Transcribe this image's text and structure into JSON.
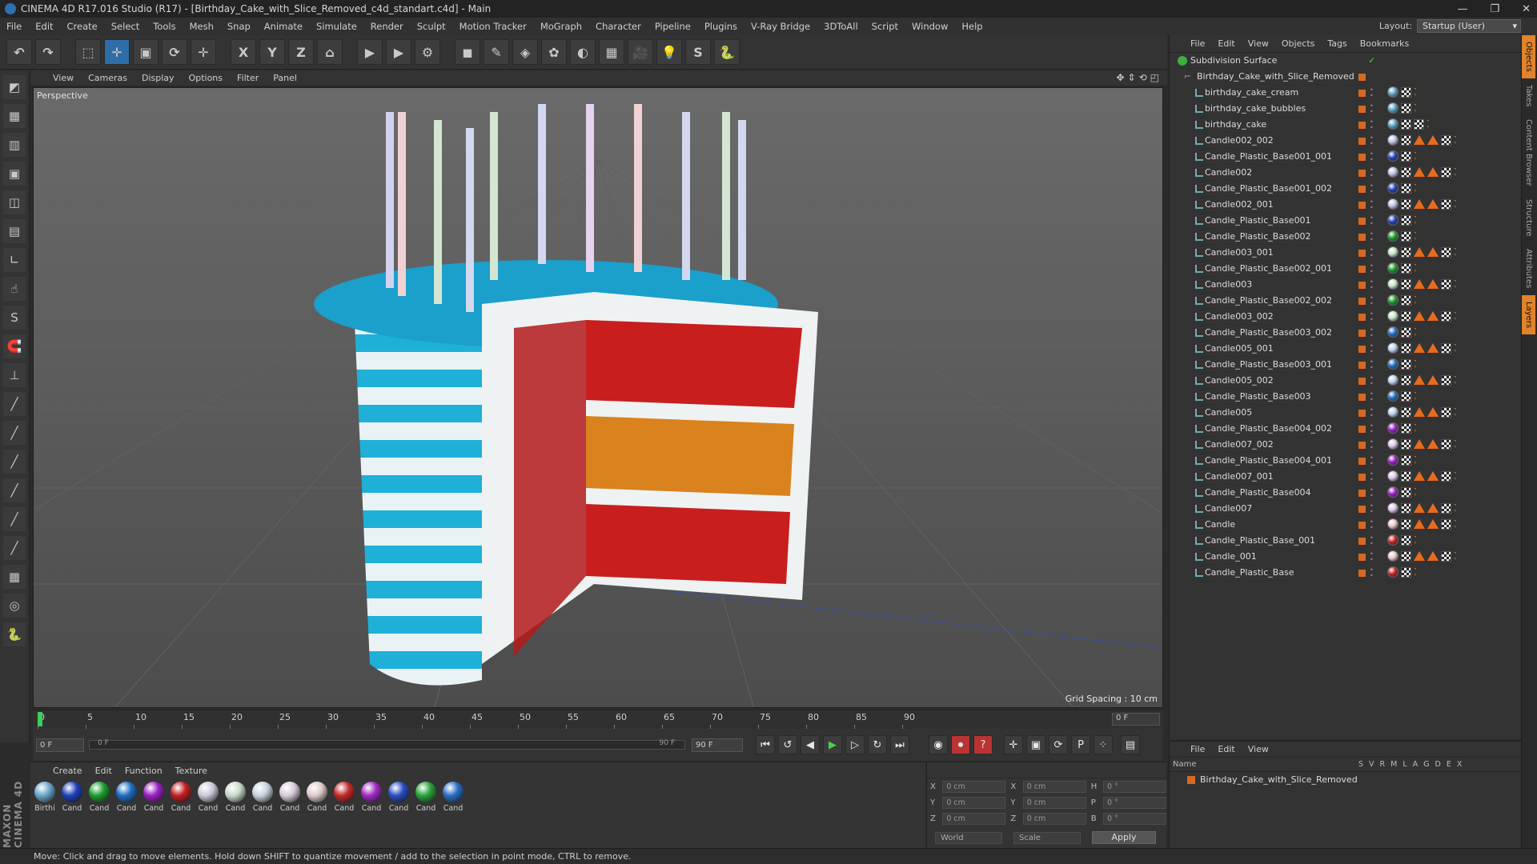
{
  "window": {
    "title": "CINEMA 4D R17.016 Studio (R17) - [Birthday_Cake_with_Slice_Removed_c4d_standart.c4d] - Main",
    "controls": [
      "—",
      "❐",
      "✕"
    ]
  },
  "menubar": {
    "items": [
      "File",
      "Edit",
      "Create",
      "Select",
      "Tools",
      "Mesh",
      "Snap",
      "Animate",
      "Simulate",
      "Render",
      "Sculpt",
      "Motion Tracker",
      "MoGraph",
      "Character",
      "Pipeline",
      "Plugins",
      "V-Ray Bridge",
      "3DToAll",
      "Script",
      "Window",
      "Help"
    ],
    "layout_label": "Layout:",
    "layout_value": "Startup (User)"
  },
  "toolbar": {
    "buttons": [
      {
        "name": "undo-icon",
        "glyph": "↶"
      },
      {
        "name": "redo-icon",
        "glyph": "↷"
      },
      {
        "name": "live-selection-icon",
        "glyph": "⬚"
      },
      {
        "name": "move-icon",
        "glyph": "✛"
      },
      {
        "name": "scale-icon",
        "glyph": "▣"
      },
      {
        "name": "rotate-icon",
        "glyph": "⟳"
      },
      {
        "name": "last-tool-icon",
        "glyph": "✛"
      },
      {
        "name": "x-axis-icon",
        "glyph": "X"
      },
      {
        "name": "y-axis-icon",
        "glyph": "Y"
      },
      {
        "name": "z-axis-icon",
        "glyph": "Z"
      },
      {
        "name": "coordinate-system-icon",
        "glyph": "⌂"
      },
      {
        "name": "render-view-icon",
        "glyph": "▶"
      },
      {
        "name": "render-picture-viewer-icon",
        "glyph": "▶"
      },
      {
        "name": "render-settings-icon",
        "glyph": "⚙"
      },
      {
        "name": "cube-icon",
        "glyph": "◼"
      },
      {
        "name": "pen-icon",
        "glyph": "✎"
      },
      {
        "name": "subdivision-icon",
        "glyph": "◈"
      },
      {
        "name": "array-icon",
        "glyph": "✿"
      },
      {
        "name": "deformer-icon",
        "glyph": "◐"
      },
      {
        "name": "floor-icon",
        "glyph": "▦"
      },
      {
        "name": "camera-icon",
        "glyph": "🎥"
      },
      {
        "name": "light-icon",
        "glyph": "💡"
      },
      {
        "name": "script-icon",
        "glyph": "S"
      },
      {
        "name": "python-icon",
        "glyph": "🐍"
      }
    ]
  },
  "left_tools": [
    "◩",
    "▦",
    "▥",
    "▣",
    "◫",
    "▤",
    "∟",
    "☝",
    "S",
    "🧲",
    "⊥",
    "╱",
    "╱",
    "╱",
    "╱",
    "╱",
    "╱",
    "▦",
    "◎",
    "🐍"
  ],
  "maxon": "MAXON CINEMA 4D",
  "viewport": {
    "menu": [
      "View",
      "Cameras",
      "Display",
      "Options",
      "Filter",
      "Panel"
    ],
    "nav": "✥⇕⟲◰",
    "label": "Perspective",
    "grid_spacing": "Grid Spacing : 10 cm"
  },
  "timeline": {
    "ticks": [
      "0",
      "5",
      "10",
      "15",
      "20",
      "25",
      "30",
      "35",
      "40",
      "45",
      "50",
      "55",
      "60",
      "65",
      "70",
      "75",
      "80",
      "85",
      "90"
    ],
    "current_frame": "0 F"
  },
  "transport": {
    "start_field": "0 F",
    "range_start": "0 F",
    "range_end": "90 F",
    "end_field": "90 F",
    "buttons": [
      "⏮",
      "↺",
      "◀",
      "▶",
      "▷",
      "↻",
      "⏭"
    ]
  },
  "materials": {
    "menu": [
      "Create",
      "Edit",
      "Function",
      "Texture"
    ],
    "items": [
      {
        "label": "Birthi",
        "color": "#6aa6c9"
      },
      {
        "label": "Cand",
        "color": "#1f3fb8"
      },
      {
        "label": "Cand",
        "color": "#1c9e2e"
      },
      {
        "label": "Cand",
        "color": "#1f6fc4"
      },
      {
        "label": "Cand",
        "color": "#9b1fc4"
      },
      {
        "label": "Cand",
        "color": "#c41f1f"
      },
      {
        "label": "Cand",
        "color": "#c9c9d9"
      },
      {
        "label": "Cand",
        "color": "#c9d9c9"
      },
      {
        "label": "Cand",
        "color": "#c9d2e0"
      },
      {
        "label": "Cand",
        "color": "#d9c9d9"
      },
      {
        "label": "Cand",
        "color": "#e0c9c9"
      },
      {
        "label": "Cand",
        "color": "#c42a2a"
      },
      {
        "label": "Cand",
        "color": "#a12ac4"
      },
      {
        "label": "Cand",
        "color": "#2a4fc4"
      },
      {
        "label": "Cand",
        "color": "#2aa43a"
      },
      {
        "label": "Cand",
        "color": "#2a6ec4"
      }
    ]
  },
  "coordinates": {
    "rows": [
      {
        "a": "X",
        "av": "0 cm",
        "b": "X",
        "bv": "0 cm",
        "c": "H",
        "cv": "0 °"
      },
      {
        "a": "Y",
        "av": "0 cm",
        "b": "Y",
        "bv": "0 cm",
        "c": "P",
        "cv": "0 °"
      },
      {
        "a": "Z",
        "av": "0 cm",
        "b": "Z",
        "bv": "0 cm",
        "c": "B",
        "cv": "0 °"
      }
    ],
    "mode": "World",
    "scale": "Scale",
    "apply": "Apply"
  },
  "status": "Move: Click and drag to move elements. Hold down SHIFT to quantize movement / add to the selection in point mode, CTRL to remove.",
  "objects": {
    "menu": [
      "File",
      "Edit",
      "View",
      "Objects",
      "Tags",
      "Bookmarks"
    ],
    "root": "Subdivision Surface",
    "group": "Birthday_Cake_with_Slice_Removed",
    "items": [
      {
        "name": "birthday_cake_cream",
        "tag": "#5fa3c8",
        "candle": false,
        "extra": false
      },
      {
        "name": "birthday_cake_bubbles",
        "tag": "#5fa3c8",
        "candle": false,
        "extra": false
      },
      {
        "name": "birthday_cake",
        "tag": "#5fa3c8",
        "candle": false,
        "extra": true
      },
      {
        "name": "Candle002_002",
        "tag": "#b9c6e6",
        "candle": true,
        "extra": false
      },
      {
        "name": "Candle_Plastic_Base001_001",
        "tag": "#1f3fb8",
        "candle": false,
        "extra": false
      },
      {
        "name": "Candle002",
        "tag": "#b9c6e6",
        "candle": true,
        "extra": false
      },
      {
        "name": "Candle_Plastic_Base001_002",
        "tag": "#1f3fb8",
        "candle": false,
        "extra": false
      },
      {
        "name": "Candle002_001",
        "tag": "#b9c6e6",
        "candle": true,
        "extra": false
      },
      {
        "name": "Candle_Plastic_Base001",
        "tag": "#1f3fb8",
        "candle": false,
        "extra": false
      },
      {
        "name": "Candle_Plastic_Base002",
        "tag": "#1c9e2e",
        "candle": false,
        "extra": false
      },
      {
        "name": "Candle003_001",
        "tag": "#c6e6c6",
        "candle": true,
        "extra": false
      },
      {
        "name": "Candle_Plastic_Base002_001",
        "tag": "#1c9e2e",
        "candle": false,
        "extra": false
      },
      {
        "name": "Candle003",
        "tag": "#c6e6c6",
        "candle": true,
        "extra": false
      },
      {
        "name": "Candle_Plastic_Base002_002",
        "tag": "#1c9e2e",
        "candle": false,
        "extra": false
      },
      {
        "name": "Candle003_002",
        "tag": "#c6e6c6",
        "candle": true,
        "extra": false
      },
      {
        "name": "Candle_Plastic_Base003_002",
        "tag": "#1f6fc4",
        "candle": false,
        "extra": false
      },
      {
        "name": "Candle005_001",
        "tag": "#bcd2ea",
        "candle": true,
        "extra": false
      },
      {
        "name": "Candle_Plastic_Base003_001",
        "tag": "#1f6fc4",
        "candle": false,
        "extra": false
      },
      {
        "name": "Candle005_002",
        "tag": "#bcd2ea",
        "candle": true,
        "extra": false
      },
      {
        "name": "Candle_Plastic_Base003",
        "tag": "#1f6fc4",
        "candle": false,
        "extra": false
      },
      {
        "name": "Candle005",
        "tag": "#bcd2ea",
        "candle": true,
        "extra": false
      },
      {
        "name": "Candle_Plastic_Base004_002",
        "tag": "#9b1fc4",
        "candle": false,
        "extra": false
      },
      {
        "name": "Candle007_002",
        "tag": "#e0c6ea",
        "candle": true,
        "extra": false
      },
      {
        "name": "Candle_Plastic_Base004_001",
        "tag": "#9b1fc4",
        "candle": false,
        "extra": false
      },
      {
        "name": "Candle007_001",
        "tag": "#e0c6ea",
        "candle": true,
        "extra": false
      },
      {
        "name": "Candle_Plastic_Base004",
        "tag": "#9b1fc4",
        "candle": false,
        "extra": false
      },
      {
        "name": "Candle007",
        "tag": "#e0c6ea",
        "candle": true,
        "extra": false
      },
      {
        "name": "Candle",
        "tag": "#eac6c6",
        "candle": true,
        "extra": false
      },
      {
        "name": "Candle_Plastic_Base_001",
        "tag": "#c41f1f",
        "candle": false,
        "extra": false
      },
      {
        "name": "Candle_001",
        "tag": "#eac6c6",
        "candle": true,
        "extra": false
      },
      {
        "name": "Candle_Plastic_Base",
        "tag": "#c41f1f",
        "candle": false,
        "extra": false
      }
    ]
  },
  "layers": {
    "menu": [
      "File",
      "Edit",
      "View"
    ],
    "name_header": "Name",
    "columns": [
      "S",
      "V",
      "R",
      "M",
      "L",
      "A",
      "G",
      "D",
      "E",
      "X"
    ],
    "row": "Birthday_Cake_with_Slice_Removed"
  },
  "sidetabs": [
    "Objects",
    "Takes",
    "Content Browser",
    "Structure",
    "Attributes",
    "Layers"
  ]
}
